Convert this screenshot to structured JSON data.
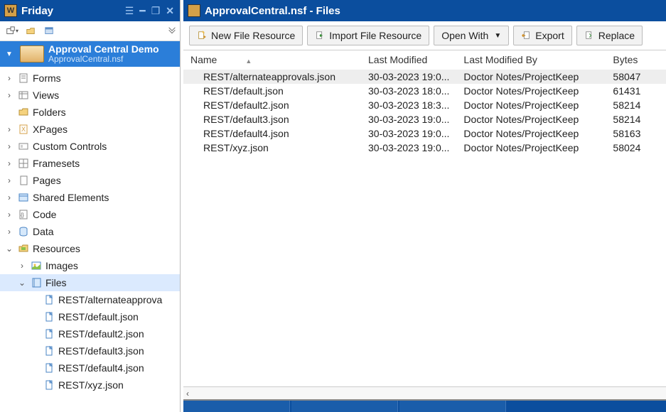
{
  "app": {
    "title": "Friday"
  },
  "project": {
    "title": "Approval Central Demo",
    "subtitle": "ApprovalCentral.nsf"
  },
  "tree": {
    "forms": "Forms",
    "views": "Views",
    "folders": "Folders",
    "xpages": "XPages",
    "custom_controls": "Custom Controls",
    "framesets": "Framesets",
    "pages": "Pages",
    "shared_elements": "Shared Elements",
    "code": "Code",
    "data": "Data",
    "resources": "Resources",
    "images": "Images",
    "files": "Files",
    "file_items": [
      "REST/alternateapprova",
      "REST/default.json",
      "REST/default2.json",
      "REST/default3.json",
      "REST/default4.json",
      "REST/xyz.json"
    ]
  },
  "rightPane": {
    "title": "ApprovalCentral.nsf - Files",
    "toolbar": {
      "new_file": "New File Resource",
      "import_file": "Import File Resource",
      "open_with": "Open With",
      "export": "Export",
      "replace": "Replace"
    },
    "columns": {
      "name": "Name",
      "modified": "Last Modified",
      "modified_by": "Last Modified By",
      "bytes": "Bytes"
    },
    "rows": [
      {
        "name": "REST/alternateapprovals.json",
        "modified": "30-03-2023 19:0...",
        "by": "Doctor Notes/ProjectKeep",
        "bytes": "58047",
        "selected": true
      },
      {
        "name": "REST/default.json",
        "modified": "30-03-2023 18:0...",
        "by": "Doctor Notes/ProjectKeep",
        "bytes": "61431",
        "selected": false
      },
      {
        "name": "REST/default2.json",
        "modified": "30-03-2023 18:3...",
        "by": "Doctor Notes/ProjectKeep",
        "bytes": "58214",
        "selected": false
      },
      {
        "name": "REST/default3.json",
        "modified": "30-03-2023 19:0...",
        "by": "Doctor Notes/ProjectKeep",
        "bytes": "58214",
        "selected": false
      },
      {
        "name": "REST/default4.json",
        "modified": "30-03-2023 19:0...",
        "by": "Doctor Notes/ProjectKeep",
        "bytes": "58163",
        "selected": false
      },
      {
        "name": "REST/xyz.json",
        "modified": "30-03-2023 19:0...",
        "by": "Doctor Notes/ProjectKeep",
        "bytes": "58024",
        "selected": false
      }
    ]
  }
}
